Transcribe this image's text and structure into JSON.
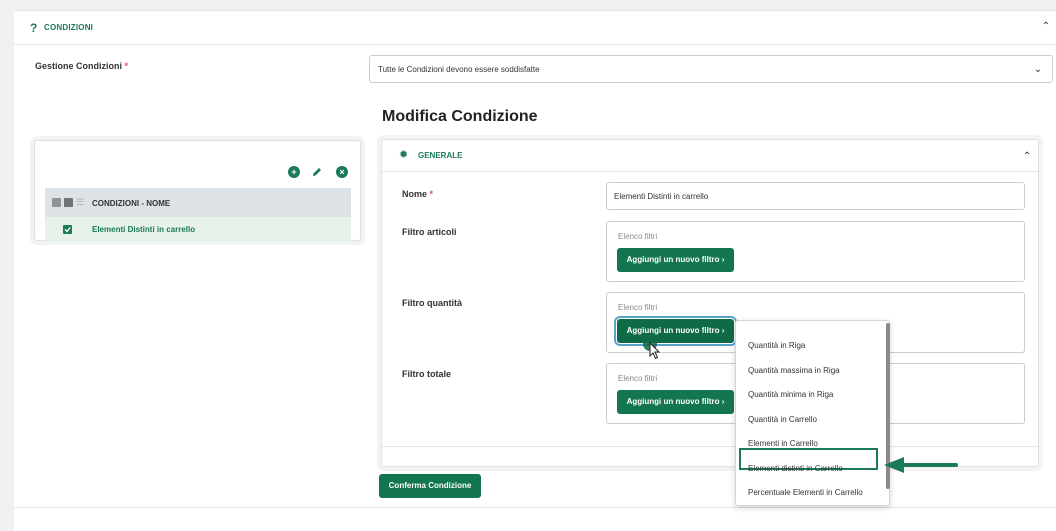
{
  "section": {
    "icon": "question-icon",
    "title": "CONDIZIONI"
  },
  "gestione": {
    "label": "Gestione Condizioni",
    "required_mark": "*",
    "selected": "Tutte le Condizioni devono essere soddisfatte"
  },
  "heading": "Modifica Condizione",
  "conditions_panel": {
    "tools": [
      "add-icon",
      "edit-icon",
      "remove-icon"
    ],
    "header": "CONDIZIONI - NOME",
    "rows": [
      {
        "name": "Elementi Distinti in carrello",
        "checked": true
      }
    ]
  },
  "general_panel": {
    "icon": "gear-icon",
    "title": "GENERALE",
    "nome": {
      "label": "Nome",
      "required_mark": "*",
      "value": "Elementi Distinti in carrello"
    },
    "filtro_articoli": {
      "label": "Filtro articoli",
      "placeholder": "Elenco filtri",
      "button": "Aggiungi un nuovo filtro ›"
    },
    "filtro_quantita": {
      "label": "Filtro quantità",
      "placeholder": "Elenco filtri",
      "button": "Aggiungi un nuovo filtro ›"
    },
    "filtro_totale": {
      "label": "Filtro totale",
      "placeholder": "Elenco filtri",
      "button": "Aggiungi un nuovo filtro ›"
    }
  },
  "confirm_button": "Conferma Condizione",
  "dropdown": {
    "items": [
      "Quantità in Riga",
      "Quantità massima in Riga",
      "Quantità minima in Riga",
      "Quantità in Carrello",
      "Elementi in Carrello",
      "Elementi distinti in Carrello",
      "Percentuale Elementi in Carrello"
    ],
    "highlighted": "Elementi distinti in Carrello"
  },
  "colors": {
    "accent": "#1b7a57",
    "button": "#14764f",
    "required": "#d9534f"
  }
}
